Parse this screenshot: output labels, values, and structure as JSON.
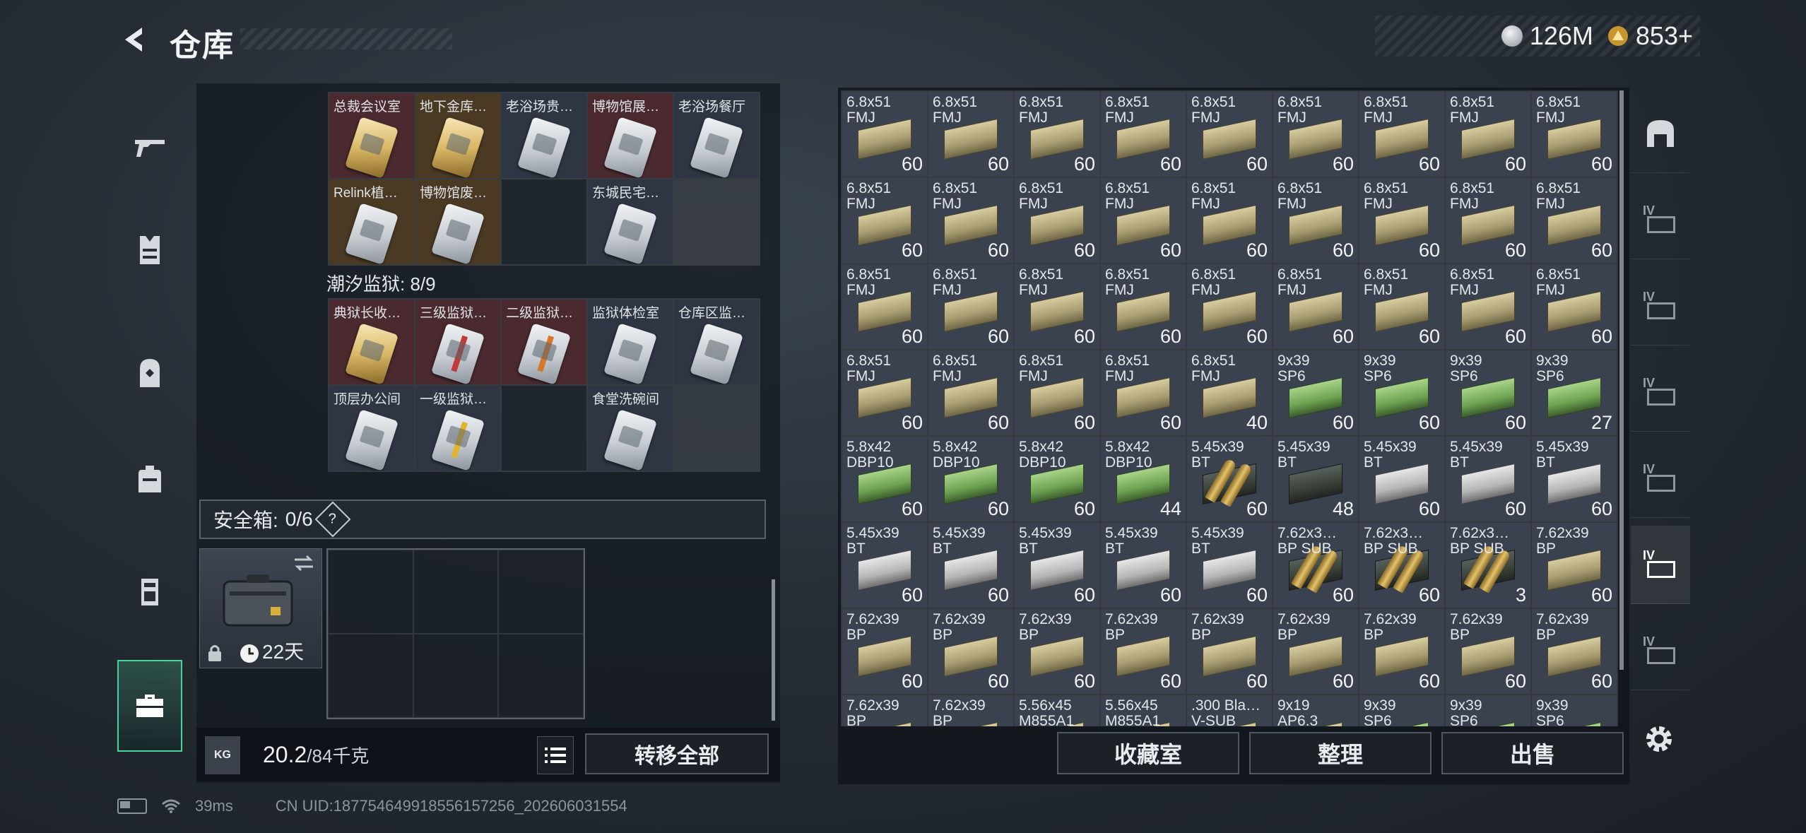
{
  "header": {
    "title": "仓库",
    "currency": [
      {
        "icon": "silver-coin-icon",
        "value": "126M",
        "color": "#b9c0c6"
      },
      {
        "icon": "gold-triangle-coin-icon",
        "value": "853+",
        "color": "#d9a441"
      }
    ]
  },
  "side_nav": [
    {
      "name": "weapon",
      "icon": "gun-icon",
      "active": false
    },
    {
      "name": "armor",
      "icon": "vest-icon",
      "active": false
    },
    {
      "name": "helmet",
      "icon": "helmet-icon",
      "active": false
    },
    {
      "name": "backpack",
      "icon": "backpack-icon",
      "active": false
    },
    {
      "name": "rig",
      "icon": "chest-rig-icon",
      "active": false
    },
    {
      "name": "storage",
      "icon": "toolbox-icon",
      "active": true
    }
  ],
  "keycards_top": [
    {
      "label": "总裁会议室",
      "tint": "red",
      "card": "gold"
    },
    {
      "label": "地下金库…",
      "tint": "gold",
      "card": "gold"
    },
    {
      "label": "老浴场贵…",
      "tint": "gray",
      "card": "white"
    },
    {
      "label": "博物馆展…",
      "tint": "red",
      "card": "white"
    },
    {
      "label": "老浴场餐厅",
      "tint": "gray",
      "card": "white"
    },
    {
      "label": "Relink植…",
      "tint": "gold",
      "card": "white"
    },
    {
      "label": "博物馆废…",
      "tint": "gold",
      "card": "white"
    },
    {
      "label": "",
      "tint": "empty",
      "card": "none"
    },
    {
      "label": "东城民宅…",
      "tint": "gray",
      "card": "white"
    }
  ],
  "prison": {
    "title": "潮汐监狱: 8/9",
    "cards": [
      {
        "label": "典狱长收…",
        "tint": "red",
        "card": "gold"
      },
      {
        "label": "三级监狱…",
        "tint": "red",
        "card": "red"
      },
      {
        "label": "二级监狱…",
        "tint": "red",
        "card": "orange"
      },
      {
        "label": "监狱体检室",
        "tint": "gray",
        "card": "white"
      },
      {
        "label": "仓库区监…",
        "tint": "gray",
        "card": "white"
      },
      {
        "label": "顶层办公间",
        "tint": "gray",
        "card": "white"
      },
      {
        "label": "一级监狱…",
        "tint": "gray",
        "card": "yellow"
      },
      {
        "label": "",
        "tint": "empty",
        "card": "none"
      },
      {
        "label": "食堂洗碗间",
        "tint": "gray",
        "card": "white"
      }
    ]
  },
  "safebox": {
    "label": "安全箱:",
    "count": "0/6",
    "help": "?",
    "days": "22天"
  },
  "weight": {
    "current": "20.2",
    "max": "/84千克",
    "icon_text": "KG"
  },
  "buttons": {
    "transfer_all": "转移全部",
    "collection": "收藏室",
    "sort": "整理",
    "sell": "出售"
  },
  "status": {
    "ping": "39ms",
    "uid": "CN UID:18775464991855615725​6_202606031554"
  },
  "ammo": [
    {
      "n1": "6.8x51",
      "n2": "FMJ",
      "c": "60",
      "box": "tan"
    },
    {
      "n1": "6.8x51",
      "n2": "FMJ",
      "c": "60",
      "box": "tan"
    },
    {
      "n1": "6.8x51",
      "n2": "FMJ",
      "c": "60",
      "box": "tan"
    },
    {
      "n1": "6.8x51",
      "n2": "FMJ",
      "c": "60",
      "box": "tan"
    },
    {
      "n1": "6.8x51",
      "n2": "FMJ",
      "c": "60",
      "box": "tan"
    },
    {
      "n1": "6.8x51",
      "n2": "FMJ",
      "c": "60",
      "box": "tan"
    },
    {
      "n1": "6.8x51",
      "n2": "FMJ",
      "c": "60",
      "box": "tan"
    },
    {
      "n1": "6.8x51",
      "n2": "FMJ",
      "c": "60",
      "box": "tan"
    },
    {
      "n1": "6.8x51",
      "n2": "FMJ",
      "c": "60",
      "box": "tan"
    },
    {
      "n1": "6.8x51",
      "n2": "FMJ",
      "c": "60",
      "box": "tan"
    },
    {
      "n1": "6.8x51",
      "n2": "FMJ",
      "c": "60",
      "box": "tan"
    },
    {
      "n1": "6.8x51",
      "n2": "FMJ",
      "c": "60",
      "box": "tan"
    },
    {
      "n1": "6.8x51",
      "n2": "FMJ",
      "c": "60",
      "box": "tan"
    },
    {
      "n1": "6.8x51",
      "n2": "FMJ",
      "c": "60",
      "box": "tan"
    },
    {
      "n1": "6.8x51",
      "n2": "FMJ",
      "c": "60",
      "box": "tan"
    },
    {
      "n1": "6.8x51",
      "n2": "FMJ",
      "c": "60",
      "box": "tan"
    },
    {
      "n1": "6.8x51",
      "n2": "FMJ",
      "c": "60",
      "box": "tan"
    },
    {
      "n1": "6.8x51",
      "n2": "FMJ",
      "c": "60",
      "box": "tan"
    },
    {
      "n1": "6.8x51",
      "n2": "FMJ",
      "c": "60",
      "box": "tan"
    },
    {
      "n1": "6.8x51",
      "n2": "FMJ",
      "c": "60",
      "box": "tan"
    },
    {
      "n1": "6.8x51",
      "n2": "FMJ",
      "c": "60",
      "box": "tan"
    },
    {
      "n1": "6.8x51",
      "n2": "FMJ",
      "c": "60",
      "box": "tan"
    },
    {
      "n1": "6.8x51",
      "n2": "FMJ",
      "c": "60",
      "box": "tan"
    },
    {
      "n1": "6.8x51",
      "n2": "FMJ",
      "c": "60",
      "box": "tan"
    },
    {
      "n1": "6.8x51",
      "n2": "FMJ",
      "c": "60",
      "box": "tan"
    },
    {
      "n1": "6.8x51",
      "n2": "FMJ",
      "c": "60",
      "box": "tan"
    },
    {
      "n1": "6.8x51",
      "n2": "FMJ",
      "c": "60",
      "box": "tan"
    },
    {
      "n1": "6.8x51",
      "n2": "FMJ",
      "c": "60",
      "box": "tan"
    },
    {
      "n1": "6.8x51",
      "n2": "FMJ",
      "c": "60",
      "box": "tan"
    },
    {
      "n1": "6.8x51",
      "n2": "FMJ",
      "c": "60",
      "box": "tan"
    },
    {
      "n1": "6.8x51",
      "n2": "FMJ",
      "c": "60",
      "box": "tan"
    },
    {
      "n1": "6.8x51",
      "n2": "FMJ",
      "c": "40",
      "box": "tan"
    },
    {
      "n1": "9x39",
      "n2": "SP6",
      "c": "60",
      "box": "green"
    },
    {
      "n1": "9x39",
      "n2": "SP6",
      "c": "60",
      "box": "green"
    },
    {
      "n1": "9x39",
      "n2": "SP6",
      "c": "60",
      "box": "green"
    },
    {
      "n1": "9x39",
      "n2": "SP6",
      "c": "27",
      "box": "green"
    },
    {
      "n1": "5.8x42",
      "n2": "DBP10",
      "c": "60",
      "box": "green"
    },
    {
      "n1": "5.8x42",
      "n2": "DBP10",
      "c": "60",
      "box": "green"
    },
    {
      "n1": "5.8x42",
      "n2": "DBP10",
      "c": "60",
      "box": "green"
    },
    {
      "n1": "5.8x42",
      "n2": "DBP10",
      "c": "44",
      "box": "green"
    },
    {
      "n1": "5.45x39",
      "n2": "BT",
      "c": "60",
      "box": "shell"
    },
    {
      "n1": "5.45x39",
      "n2": "BT",
      "c": "48",
      "box": "dark"
    },
    {
      "n1": "5.45x39",
      "n2": "BT",
      "c": "60",
      "box": "gray"
    },
    {
      "n1": "5.45x39",
      "n2": "BT",
      "c": "60",
      "box": "gray"
    },
    {
      "n1": "5.45x39",
      "n2": "BT",
      "c": "60",
      "box": "gray"
    },
    {
      "n1": "5.45x39",
      "n2": "BT",
      "c": "60",
      "box": "gray"
    },
    {
      "n1": "5.45x39",
      "n2": "BT",
      "c": "60",
      "box": "gray"
    },
    {
      "n1": "5.45x39",
      "n2": "BT",
      "c": "60",
      "box": "gray"
    },
    {
      "n1": "5.45x39",
      "n2": "BT",
      "c": "60",
      "box": "gray"
    },
    {
      "n1": "5.45x39",
      "n2": "BT",
      "c": "60",
      "box": "gray"
    },
    {
      "n1": "7.62x3…",
      "n2": "BP SUB",
      "c": "60",
      "box": "shell"
    },
    {
      "n1": "7.62x3…",
      "n2": "BP SUB",
      "c": "60",
      "box": "shell"
    },
    {
      "n1": "7.62x3…",
      "n2": "BP SUB",
      "c": "3",
      "box": "shell"
    },
    {
      "n1": "7.62x39",
      "n2": "BP",
      "c": "60",
      "box": "tan"
    },
    {
      "n1": "7.62x39",
      "n2": "BP",
      "c": "60",
      "box": "tan"
    },
    {
      "n1": "7.62x39",
      "n2": "BP",
      "c": "60",
      "box": "tan"
    },
    {
      "n1": "7.62x39",
      "n2": "BP",
      "c": "60",
      "box": "tan"
    },
    {
      "n1": "7.62x39",
      "n2": "BP",
      "c": "60",
      "box": "tan"
    },
    {
      "n1": "7.62x39",
      "n2": "BP",
      "c": "60",
      "box": "tan"
    },
    {
      "n1": "7.62x39",
      "n2": "BP",
      "c": "60",
      "box": "tan"
    },
    {
      "n1": "7.62x39",
      "n2": "BP",
      "c": "60",
      "box": "tan"
    },
    {
      "n1": "7.62x39",
      "n2": "BP",
      "c": "60",
      "box": "tan"
    },
    {
      "n1": "7.62x39",
      "n2": "BP",
      "c": "60",
      "box": "tan"
    },
    {
      "n1": "7.62x39",
      "n2": "BP",
      "c": "",
      "box": "tan"
    },
    {
      "n1": "7.62x39",
      "n2": "BP",
      "c": "",
      "box": "tan"
    },
    {
      "n1": "5.56x45",
      "n2": "M855A1",
      "c": "",
      "box": "tan"
    },
    {
      "n1": "5.56x45",
      "n2": "M855A1",
      "c": "",
      "box": "tan"
    },
    {
      "n1": ".300 Bla…",
      "n2": "V-SUB",
      "c": "",
      "box": "tan"
    },
    {
      "n1": "9x19",
      "n2": "AP6.3",
      "c": "",
      "box": "tan"
    },
    {
      "n1": "9x39",
      "n2": "SP6",
      "c": "",
      "box": "green"
    },
    {
      "n1": "9x39",
      "n2": "SP6",
      "c": "",
      "box": "green"
    },
    {
      "n1": "9x39",
      "n2": "SP6",
      "c": "",
      "box": "green"
    }
  ],
  "right_side": [
    {
      "icon": "arch-filter-icon",
      "label": ""
    },
    {
      "icon": "tier-iv-filter-icon",
      "label": "IV"
    },
    {
      "icon": "tier-iv-filter-icon",
      "label": "IV"
    },
    {
      "icon": "tier-iv-filter-icon",
      "label": "IV"
    },
    {
      "icon": "tier-iv-filter-icon",
      "label": "IV"
    },
    {
      "icon": "tier-iv-filter-icon",
      "label": "IV"
    },
    {
      "icon": "tier-iv-filter-icon",
      "label": "IV"
    }
  ]
}
